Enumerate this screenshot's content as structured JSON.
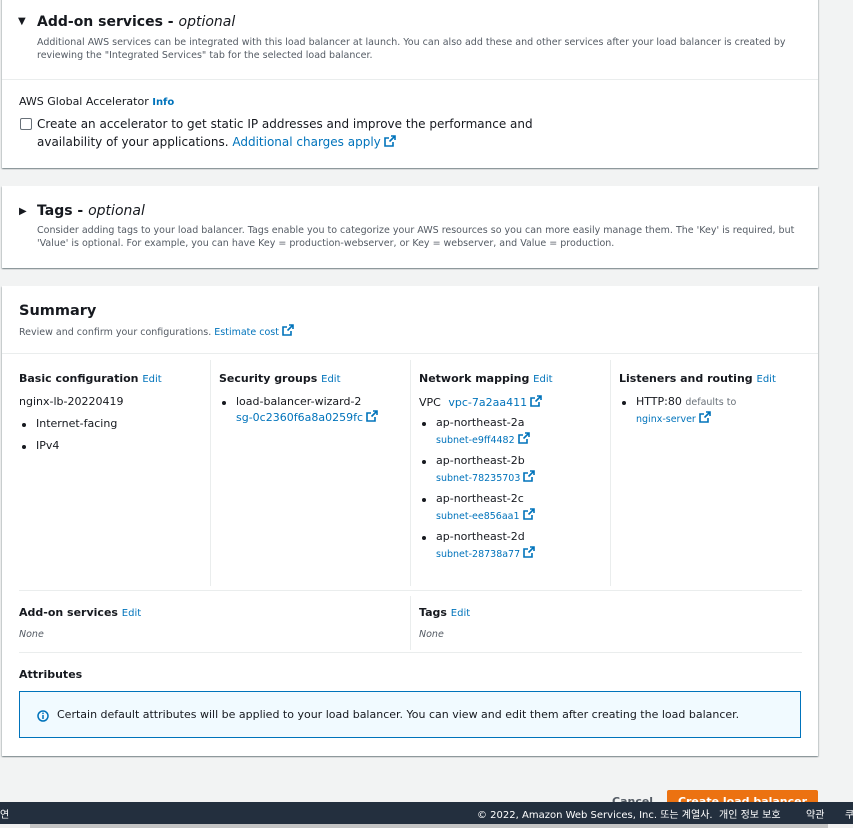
{
  "addon": {
    "title": "Add-on services - ",
    "title_optional": "optional",
    "description": "Additional AWS services can be integrated with this load balancer at launch. You can also add these and other services after your load balancer is created by reviewing the \"Integrated Services\" tab for the selected load balancer.",
    "accelerator_label": "AWS Global Accelerator",
    "info": "Info",
    "checkbox_text": "Create an accelerator to get static IP addresses and improve the performance and availability of your applications.",
    "charges_link": "Additional charges apply"
  },
  "tags": {
    "title": "Tags - ",
    "title_optional": "optional",
    "description": "Consider adding tags to your load balancer. Tags enable you to categorize your AWS resources so you can more easily manage them. The 'Key' is required, but 'Value' is optional. For example, you can have Key = production-webserver, or Key = webserver, and Value = production."
  },
  "summary": {
    "title": "Summary",
    "description": "Review and confirm your configurations.",
    "estimate_link": "Estimate cost",
    "edit": "Edit",
    "basic": {
      "heading": "Basic configuration",
      "name": "nginx-lb-20220419",
      "items": [
        "Internet-facing",
        "IPv4"
      ]
    },
    "security": {
      "heading": "Security groups",
      "group_name": "load-balancer-wizard-2",
      "group_id": "sg-0c2360f6a8a0259fc"
    },
    "network": {
      "heading": "Network mapping",
      "vpc_label": "VPC",
      "vpc_id": "vpc-7a2aa411",
      "zones": [
        {
          "az": "ap-northeast-2a",
          "subnet": "subnet-e9ff4482"
        },
        {
          "az": "ap-northeast-2b",
          "subnet": "subnet-78235703"
        },
        {
          "az": "ap-northeast-2c",
          "subnet": "subnet-ee856aa1"
        },
        {
          "az": "ap-northeast-2d",
          "subnet": "subnet-28738a77"
        }
      ]
    },
    "listeners": {
      "heading": "Listeners and routing",
      "listener": "HTTP:80",
      "defaults_to": "defaults to",
      "target": "nginx-server"
    },
    "addons": {
      "heading": "Add-on services",
      "value": "None"
    },
    "tags": {
      "heading": "Tags",
      "value": "None"
    },
    "attributes": {
      "heading": "Attributes",
      "alert": "Certain default attributes will be applied to your load balancer. You can view and edit them after creating the load balancer."
    }
  },
  "actions": {
    "cancel": "Cancel",
    "create": "Create load balancer"
  },
  "footer": {
    "left_fragment": "연",
    "copyright": "© 2022, Amazon Web Services, Inc. 또는 계열사.",
    "privacy": "개인 정보 보호",
    "terms": "약관",
    "cookie_fragment": "쿠"
  },
  "colors": {
    "link": "#0073bb",
    "accent": "#ec7211",
    "footer_bg": "#232f3e",
    "info_border": "#0073bb"
  },
  "icons": [
    "caret-down-icon",
    "caret-right-icon",
    "external-link-icon",
    "info-circle-icon",
    "checkbox-icon"
  ]
}
